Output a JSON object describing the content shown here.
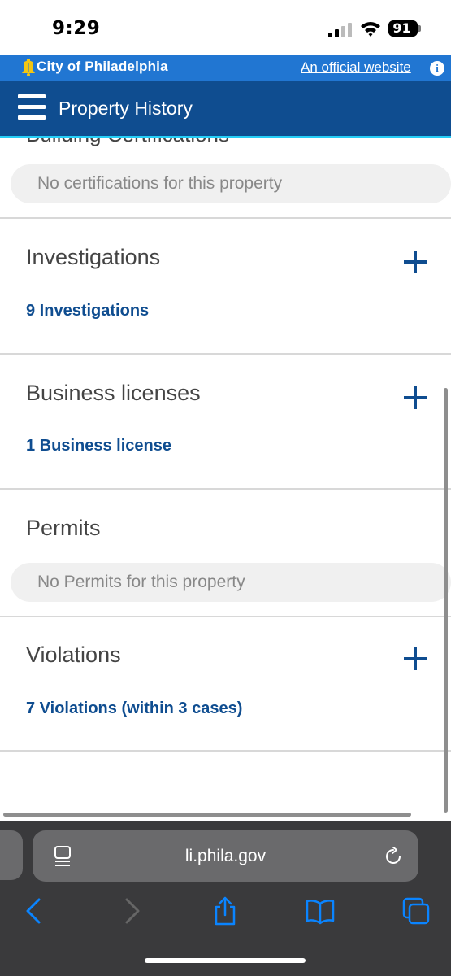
{
  "status_bar": {
    "time": "9:29",
    "battery": "91"
  },
  "city_banner": {
    "name": "City of Philadelphia",
    "official_link": "An official website",
    "info_glyph": "i"
  },
  "app_header": {
    "title": "Property History"
  },
  "sections": {
    "certifications": {
      "title": "Building Certifications",
      "empty_text": "No certifications for this property"
    },
    "investigations": {
      "title": "Investigations",
      "link": "9 Investigations"
    },
    "business_licenses": {
      "title": "Business licenses",
      "link": "1 Business license"
    },
    "permits": {
      "title": "Permits",
      "empty_text": "No Permits for this property"
    },
    "violations": {
      "title": "Violations",
      "link": "7 Violations (within 3 cases)"
    }
  },
  "browser": {
    "url": "li.phila.gov"
  },
  "colors": {
    "city_blue": "#2176d2",
    "header_navy": "#0f4d90",
    "accent_cyan": "#25cef7",
    "ios_blue": "#0a84ff"
  }
}
